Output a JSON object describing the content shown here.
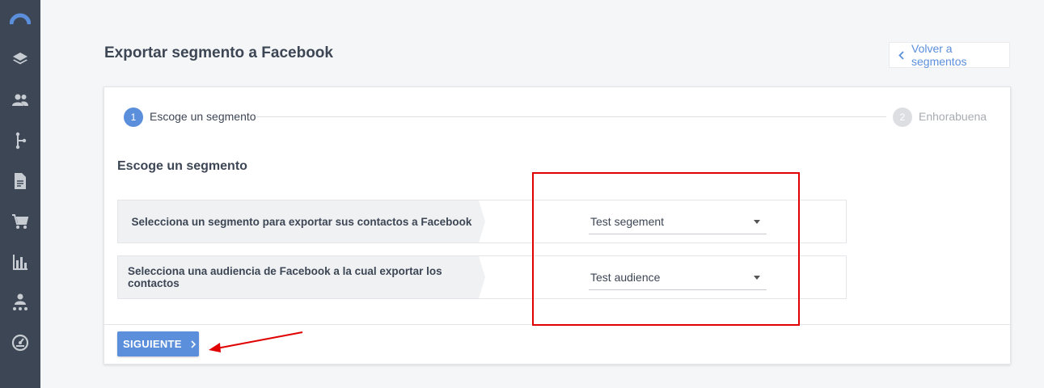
{
  "sidebar": {
    "icons": [
      "logo-arc-icon",
      "layers-icon",
      "contacts-icon",
      "flow-icon",
      "document-icon",
      "cart-icon",
      "bar-chart-icon",
      "org-icon",
      "dashboard-gauge-icon"
    ]
  },
  "header": {
    "title": "Exportar segmento a Facebook",
    "back_label": "Volver a segmentos"
  },
  "stepper": {
    "steps": [
      {
        "number": "1",
        "label": "Escoge un segmento",
        "active": true
      },
      {
        "number": "2",
        "label": "Enhorabuena",
        "active": false
      }
    ]
  },
  "main": {
    "section_title": "Escoge un segmento",
    "rows": [
      {
        "label": "Selecciona un segmento para exportar sus contactos a Facebook",
        "value": "Test segement"
      },
      {
        "label": "Selecciona una audiencia de Facebook a la cual exportar los contactos",
        "value": "Test audience"
      }
    ],
    "next_label": "SIGUIENTE"
  },
  "colors": {
    "sidebar_bg": "#3d4654",
    "accent": "#5b8fdb",
    "annotation": "#e00000"
  }
}
